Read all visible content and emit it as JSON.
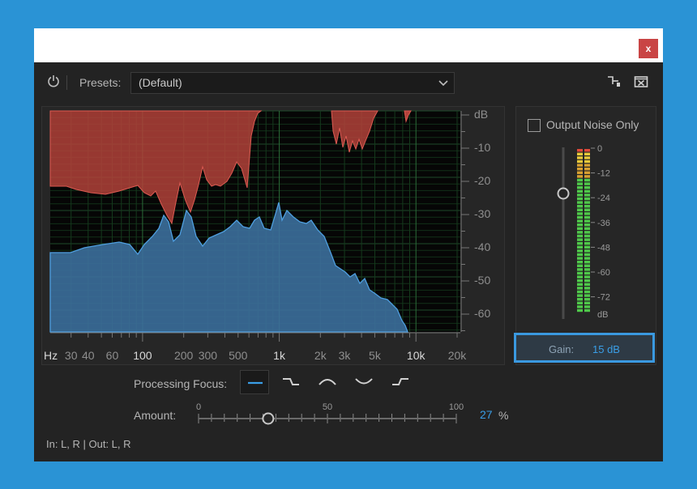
{
  "window": {
    "close_label": "x"
  },
  "toolbar": {
    "presets_label": "Presets:",
    "presets_value": "(Default)"
  },
  "graph": {
    "db_unit": "dB",
    "db_labels": [
      "-10",
      "-20",
      "-30",
      "-40",
      "-50",
      "-60"
    ],
    "freq_unit": "Hz",
    "freq_labels": [
      "30",
      "40",
      "60",
      "100",
      "200",
      "300",
      "500",
      "1k",
      "2k",
      "3k",
      "5k",
      "10k",
      "20k"
    ],
    "freq_bold": [
      "100",
      "1k",
      "10k"
    ]
  },
  "side": {
    "output_noise_label": "Output Noise Only",
    "meter_labels": [
      "0",
      "-12",
      "-24",
      "-36",
      "-48",
      "-60",
      "-72",
      "dB"
    ],
    "gain_label": "Gain:",
    "gain_value": "15 dB"
  },
  "processing_focus": {
    "label": "Processing Focus:"
  },
  "amount": {
    "label": "Amount:",
    "scale_labels": [
      "0",
      "50",
      "100"
    ],
    "value": "27",
    "unit": "%",
    "level": 27
  },
  "status": {
    "text": "In: L, R | Out: L, R"
  },
  "colors": {
    "accent": "#3a9ee6",
    "noise_red": "#c0443d",
    "signal_blue": "#3e78a8",
    "page_bg": "#2a93d5"
  }
}
